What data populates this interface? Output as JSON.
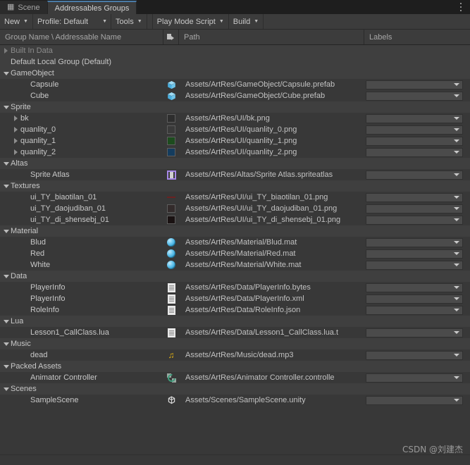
{
  "window": {
    "tabs": [
      {
        "label": "Scene",
        "icon": "grid-icon",
        "active": false
      },
      {
        "label": "Addressables Groups",
        "icon": "none",
        "active": true
      }
    ],
    "menu_icon": "kebab-menu-icon",
    "watermark": "CSDN @刘建杰"
  },
  "toolbar": {
    "new_label": "New",
    "profile_label": "Profile: Default",
    "tools_label": "Tools",
    "play_mode_script_label": "Play Mode Script",
    "build_label": "Build",
    "caret": "▼"
  },
  "columns": {
    "name": "Group Name \\ Addressable Name",
    "icon": "asset-type-icon",
    "path": "Path",
    "labels": "Labels"
  },
  "tree": [
    {
      "kind": "group",
      "indent": 0,
      "toggle": "right",
      "name": "Built In Data",
      "dim": true,
      "icon": "",
      "path": "",
      "labels": false
    },
    {
      "kind": "group",
      "indent": 0,
      "toggle": "none",
      "name": "Default Local Group (Default)",
      "dim": false,
      "icon": "",
      "path": "",
      "labels": false
    },
    {
      "kind": "group",
      "indent": 0,
      "toggle": "down",
      "name": "GameObject",
      "dim": false,
      "icon": "",
      "path": "",
      "labels": false
    },
    {
      "kind": "asset",
      "indent": 2,
      "toggle": "none",
      "name": "Capsule",
      "icon": "prefab-cube-icon",
      "path": "Assets/ArtRes/GameObject/Capsule.prefab",
      "labels": true
    },
    {
      "kind": "asset",
      "indent": 2,
      "toggle": "none",
      "name": "Cube",
      "icon": "prefab-cube-icon",
      "path": "Assets/ArtRes/GameObject/Cube.prefab",
      "labels": true
    },
    {
      "kind": "group",
      "indent": 0,
      "toggle": "down",
      "name": "Sprite",
      "dim": false,
      "icon": "",
      "path": "",
      "labels": false
    },
    {
      "kind": "asset",
      "indent": 1,
      "toggle": "right",
      "name": "bk",
      "icon": "sprite-thumb-icon",
      "thumb": "#2e2e2e",
      "path": "Assets/ArtRes/UI/bk.png",
      "labels": true
    },
    {
      "kind": "asset",
      "indent": 1,
      "toggle": "right",
      "name": "quanlity_0",
      "icon": "sprite-thumb-icon",
      "thumb": "#3a3a3a",
      "path": "Assets/ArtRes/UI/quanlity_0.png",
      "labels": true
    },
    {
      "kind": "asset",
      "indent": 1,
      "toggle": "right",
      "name": "quanlity_1",
      "icon": "sprite-thumb-icon",
      "thumb": "#1d4c1e",
      "path": "Assets/ArtRes/UI/quanlity_1.png",
      "labels": true
    },
    {
      "kind": "asset",
      "indent": 1,
      "toggle": "right",
      "name": "quanlity_2",
      "icon": "sprite-thumb-icon",
      "thumb": "#143c5e",
      "path": "Assets/ArtRes/UI/quanlity_2.png",
      "labels": true
    },
    {
      "kind": "group",
      "indent": 0,
      "toggle": "down",
      "name": "Altas",
      "dim": false,
      "icon": "",
      "path": "",
      "labels": false
    },
    {
      "kind": "asset",
      "indent": 2,
      "toggle": "none",
      "name": "Sprite Atlas",
      "icon": "sprite-atlas-icon",
      "path": "Assets/ArtRes/Altas/Sprite Atlas.spriteatlas",
      "labels": true
    },
    {
      "kind": "group",
      "indent": 0,
      "toggle": "down",
      "name": "Textures",
      "dim": false,
      "icon": "",
      "path": "",
      "labels": false
    },
    {
      "kind": "asset",
      "indent": 2,
      "toggle": "none",
      "name": "ui_TY_biaotilan_01",
      "icon": "texture-thumb-icon",
      "thumb": "#6b2222",
      "thumbstyle": "bar",
      "path": "Assets/ArtRes/UI/ui_TY_biaotilan_01.png",
      "labels": true
    },
    {
      "kind": "asset",
      "indent": 2,
      "toggle": "none",
      "name": "ui_TY_daojudiban_01",
      "icon": "texture-thumb-icon",
      "thumb": "#332b2b",
      "path": "Assets/ArtRes/UI/ui_TY_daojudiban_01.png",
      "labels": true
    },
    {
      "kind": "asset",
      "indent": 2,
      "toggle": "none",
      "name": "ui_TY_di_shensebj_01",
      "icon": "texture-thumb-icon",
      "thumb": "#1a1212",
      "path": "Assets/ArtRes/UI/ui_TY_di_shensebj_01.png",
      "labels": true
    },
    {
      "kind": "group",
      "indent": 0,
      "toggle": "down",
      "name": "Material",
      "dim": false,
      "icon": "",
      "path": "",
      "labels": false
    },
    {
      "kind": "asset",
      "indent": 2,
      "toggle": "none",
      "name": "Blud",
      "icon": "material-sphere-icon",
      "path": "Assets/ArtRes/Material/Blud.mat",
      "labels": true
    },
    {
      "kind": "asset",
      "indent": 2,
      "toggle": "none",
      "name": "Red",
      "icon": "material-sphere-icon",
      "path": "Assets/ArtRes/Material/Red.mat",
      "labels": true
    },
    {
      "kind": "asset",
      "indent": 2,
      "toggle": "none",
      "name": "White",
      "icon": "material-sphere-icon",
      "path": "Assets/ArtRes/Material/White.mat",
      "labels": true
    },
    {
      "kind": "group",
      "indent": 0,
      "toggle": "down",
      "name": "Data",
      "dim": false,
      "icon": "",
      "path": "",
      "labels": false
    },
    {
      "kind": "asset",
      "indent": 2,
      "toggle": "none",
      "name": "PlayerInfo",
      "icon": "text-document-icon",
      "path": "Assets/ArtRes/Data/PlayerInfo.bytes",
      "labels": true
    },
    {
      "kind": "asset",
      "indent": 2,
      "toggle": "none",
      "name": "PlayerInfo",
      "icon": "text-document-icon",
      "path": "Assets/ArtRes/Data/PlayerInfo.xml",
      "labels": true
    },
    {
      "kind": "asset",
      "indent": 2,
      "toggle": "none",
      "name": "RoleInfo",
      "icon": "text-document-icon",
      "path": "Assets/ArtRes/Data/RoleInfo.json",
      "labels": true
    },
    {
      "kind": "group",
      "indent": 0,
      "toggle": "down",
      "name": "Lua",
      "dim": false,
      "icon": "",
      "path": "",
      "labels": false
    },
    {
      "kind": "asset",
      "indent": 2,
      "toggle": "none",
      "name": "Lesson1_CallClass.lua",
      "icon": "text-document-icon",
      "path": "Assets/ArtRes/Data/Lesson1_CallClass.lua.t",
      "labels": true
    },
    {
      "kind": "group",
      "indent": 0,
      "toggle": "down",
      "name": "Music",
      "dim": false,
      "icon": "",
      "path": "",
      "labels": false
    },
    {
      "kind": "asset",
      "indent": 2,
      "toggle": "none",
      "name": "dead",
      "icon": "audio-note-icon",
      "path": "Assets/ArtRes/Music/dead.mp3",
      "labels": true
    },
    {
      "kind": "group",
      "indent": 0,
      "toggle": "down",
      "name": "Packed Assets",
      "dim": false,
      "icon": "",
      "path": "",
      "labels": false
    },
    {
      "kind": "asset",
      "indent": 2,
      "toggle": "none",
      "name": "Animator Controller",
      "icon": "animator-controller-icon",
      "path": "Assets/ArtRes/Animator Controller.controlle",
      "labels": true
    },
    {
      "kind": "group",
      "indent": 0,
      "toggle": "down",
      "name": "Scenes",
      "dim": false,
      "icon": "",
      "path": "",
      "labels": false
    },
    {
      "kind": "asset",
      "indent": 2,
      "toggle": "none",
      "name": "SampleScene",
      "icon": "unity-scene-icon",
      "path": "Assets/Scenes/SampleScene.unity",
      "labels": true
    }
  ],
  "colors": {
    "window_bg": "#383838",
    "group_row_bg": "#3f3f3f",
    "tab_active_accent": "#4a7ba7",
    "toolbar_bg": "#3c3c3c",
    "text": "#c8c8c8",
    "text_dim": "#8b8b8b"
  }
}
